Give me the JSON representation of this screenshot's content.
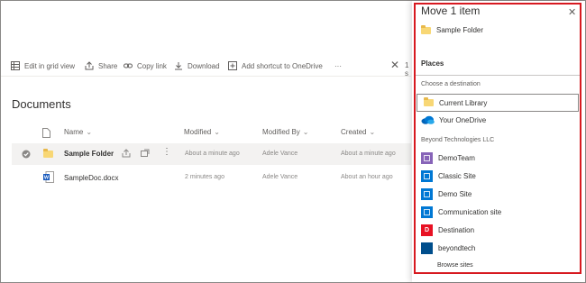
{
  "toolbar": {
    "edit_grid": "Edit in grid view",
    "share": "Share",
    "copy_link": "Copy link",
    "download": "Download",
    "add_shortcut": "Add shortcut to OneDrive",
    "more": "···",
    "selected": "1 s"
  },
  "library": {
    "title": "Documents",
    "columns": {
      "name": "Name",
      "modified": "Modified",
      "modified_by": "Modified By",
      "created": "Created"
    },
    "rows": [
      {
        "name": "Sample Folder",
        "modified": "About a minute ago",
        "modified_by": "Adele Vance",
        "created": "About a minute ago"
      },
      {
        "name": "SampleDoc.docx",
        "modified": "2 minutes ago",
        "modified_by": "Adele Vance",
        "created": "About an hour ago"
      }
    ]
  },
  "panel": {
    "title": "Move 1 item",
    "item_name": "Sample Folder",
    "places": "Places",
    "choose_destination": "Choose a destination",
    "current_library": "Current Library",
    "your_onedrive": "Your OneDrive",
    "group_label": "Beyond Technologies LLC",
    "sites": [
      {
        "name": "DemoTeam",
        "color": "#8764b8",
        "initial": ""
      },
      {
        "name": "Classic Site",
        "color": "#0078d4",
        "initial": ""
      },
      {
        "name": "Demo Site",
        "color": "#0078d4",
        "initial": ""
      },
      {
        "name": "Communication site",
        "color": "#0078d4",
        "initial": ""
      },
      {
        "name": "Destination",
        "color": "#e81123",
        "initial": "D"
      },
      {
        "name": "beyondtech",
        "color": "#004e8c",
        "initial": ""
      }
    ],
    "browse_sites": "Browse sites"
  }
}
